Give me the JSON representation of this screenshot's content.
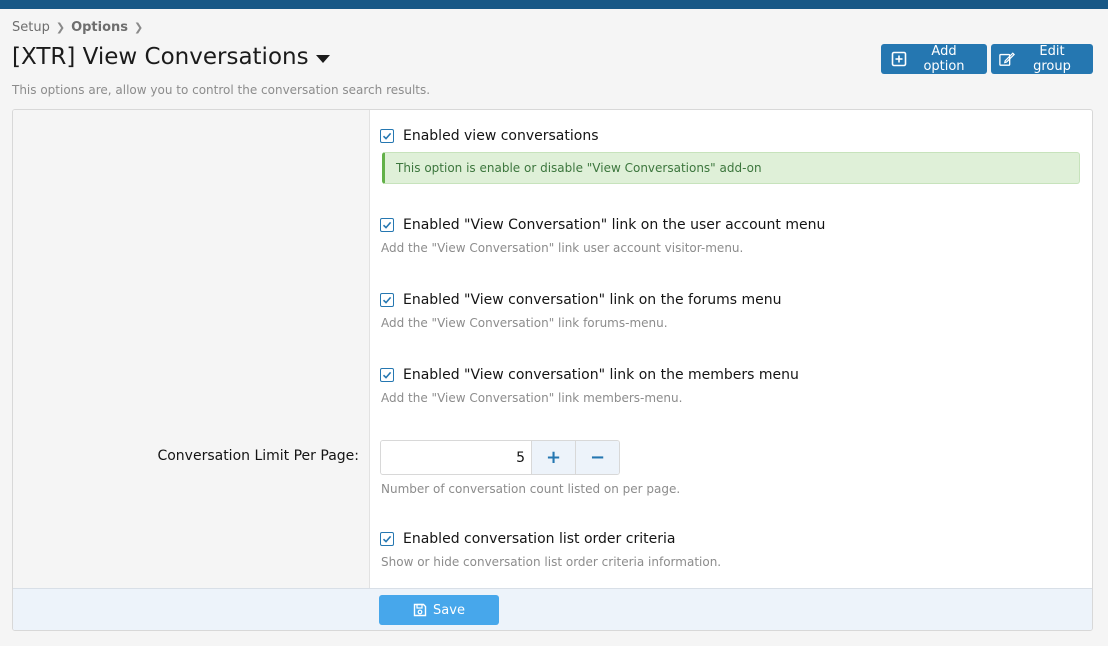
{
  "breadcrumb": {
    "items": [
      "Setup",
      "Options"
    ]
  },
  "page": {
    "title": "[XTR] View Conversations",
    "description": "This options are, allow you to control the conversation search results."
  },
  "buttons": {
    "add_option": "Add option",
    "edit_group": "Edit group",
    "save": "Save"
  },
  "options": {
    "enabled_view_conversations": {
      "label": "Enabled view conversations",
      "checked": true,
      "alert": "This option is enable or disable \"View Conversations\" add-on"
    },
    "account_menu_link": {
      "label": "Enabled \"View Conversation\" link on the user account menu",
      "checked": true,
      "hint": "Add the \"View Conversation\" link user account visitor-menu."
    },
    "forums_menu_link": {
      "label": "Enabled \"View conversation\" link on the forums menu",
      "checked": true,
      "hint": "Add the \"View Conversation\" link forums-menu."
    },
    "members_menu_link": {
      "label": "Enabled \"View conversation\" link on the members menu",
      "checked": true,
      "hint": "Add the \"View Conversation\" link members-menu."
    },
    "limit_per_page": {
      "label": "Conversation Limit Per Page:",
      "value": "5",
      "plus": "+",
      "minus": "−",
      "hint": "Number of conversation count listed on per page."
    },
    "order_criteria": {
      "label": "Enabled conversation list order criteria",
      "checked": true,
      "hint": "Show or hide conversation list order criteria information."
    }
  },
  "colors": {
    "topbar": "#185886",
    "primary": "#2577b1",
    "save": "#47a7eb",
    "success_bg": "#dff0d8",
    "success_border": "#63b149"
  },
  "icons": {
    "add": "plus-square-icon",
    "edit": "edit-icon",
    "save": "save-icon",
    "check": "check-icon",
    "caret": "caret-down-icon",
    "chevron": "chevron-right-icon"
  }
}
